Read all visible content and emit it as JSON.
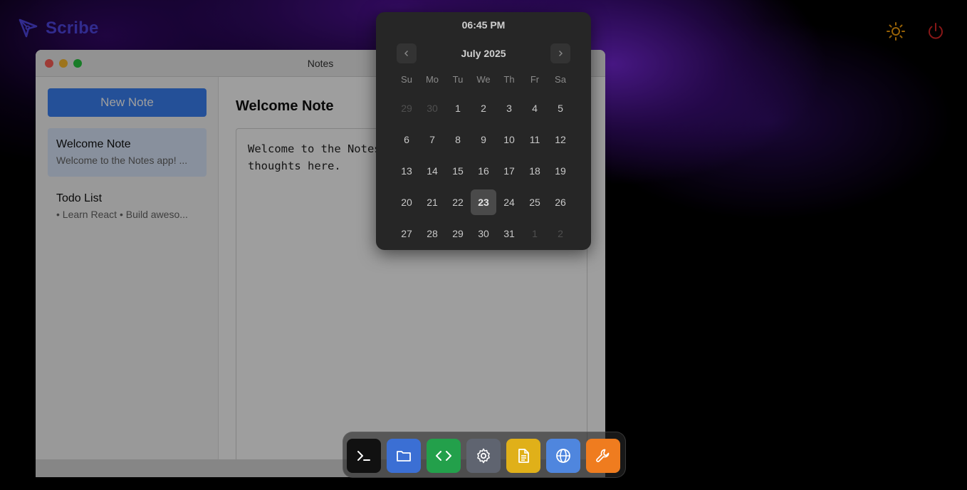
{
  "brand": {
    "name": "Scribe"
  },
  "colors": {
    "brand": "#4f46e5",
    "sun_icon": "#f59e0b",
    "power_icon": "#dc2626",
    "new_note_button": "#3b82f6",
    "selected_note": "#dbe8fd",
    "today_highlight": "#4a4a4a"
  },
  "top_controls": {
    "theme_icon": "sun-icon",
    "power_icon": "power-icon"
  },
  "notes_window": {
    "title": "Notes",
    "new_note_label": "New Note",
    "notes": [
      {
        "title": "Welcome Note",
        "preview": "Welcome to the Notes app! ...",
        "selected": true
      },
      {
        "title": "Todo List",
        "preview": "• Learn React • Build aweso...",
        "selected": false
      }
    ],
    "editor": {
      "title": "Welcome Note",
      "content": "Welcome to the Notes app! Write your\nthoughts here."
    }
  },
  "calendar": {
    "time": "06:45 PM",
    "month_label": "July 2025",
    "weekdays": [
      "Su",
      "Mo",
      "Tu",
      "We",
      "Th",
      "Fr",
      "Sa"
    ],
    "days": [
      {
        "label": "29",
        "muted": true
      },
      {
        "label": "30",
        "muted": true
      },
      {
        "label": "1"
      },
      {
        "label": "2"
      },
      {
        "label": "3"
      },
      {
        "label": "4"
      },
      {
        "label": "5"
      },
      {
        "label": "6"
      },
      {
        "label": "7"
      },
      {
        "label": "8"
      },
      {
        "label": "9"
      },
      {
        "label": "10"
      },
      {
        "label": "11"
      },
      {
        "label": "12"
      },
      {
        "label": "13"
      },
      {
        "label": "14"
      },
      {
        "label": "15"
      },
      {
        "label": "16"
      },
      {
        "label": "17"
      },
      {
        "label": "18"
      },
      {
        "label": "19"
      },
      {
        "label": "20"
      },
      {
        "label": "21"
      },
      {
        "label": "22"
      },
      {
        "label": "23",
        "today": true
      },
      {
        "label": "24"
      },
      {
        "label": "25"
      },
      {
        "label": "26"
      },
      {
        "label": "27"
      },
      {
        "label": "28"
      },
      {
        "label": "29"
      },
      {
        "label": "30"
      },
      {
        "label": "31"
      },
      {
        "label": "1",
        "muted": true
      },
      {
        "label": "2",
        "muted": true
      }
    ]
  },
  "dock": {
    "apps": [
      {
        "icon": "terminal-icon",
        "color": "#111111"
      },
      {
        "icon": "folder-icon",
        "color": "#3b6fd4"
      },
      {
        "icon": "code-icon",
        "color": "#23a04b"
      },
      {
        "icon": "gear-icon",
        "color": "#5f6470"
      },
      {
        "icon": "document-icon",
        "color": "#e0b019"
      },
      {
        "icon": "globe-icon",
        "color": "#4f86de"
      },
      {
        "icon": "wrench-icon",
        "color": "#ef7c1f"
      }
    ]
  }
}
